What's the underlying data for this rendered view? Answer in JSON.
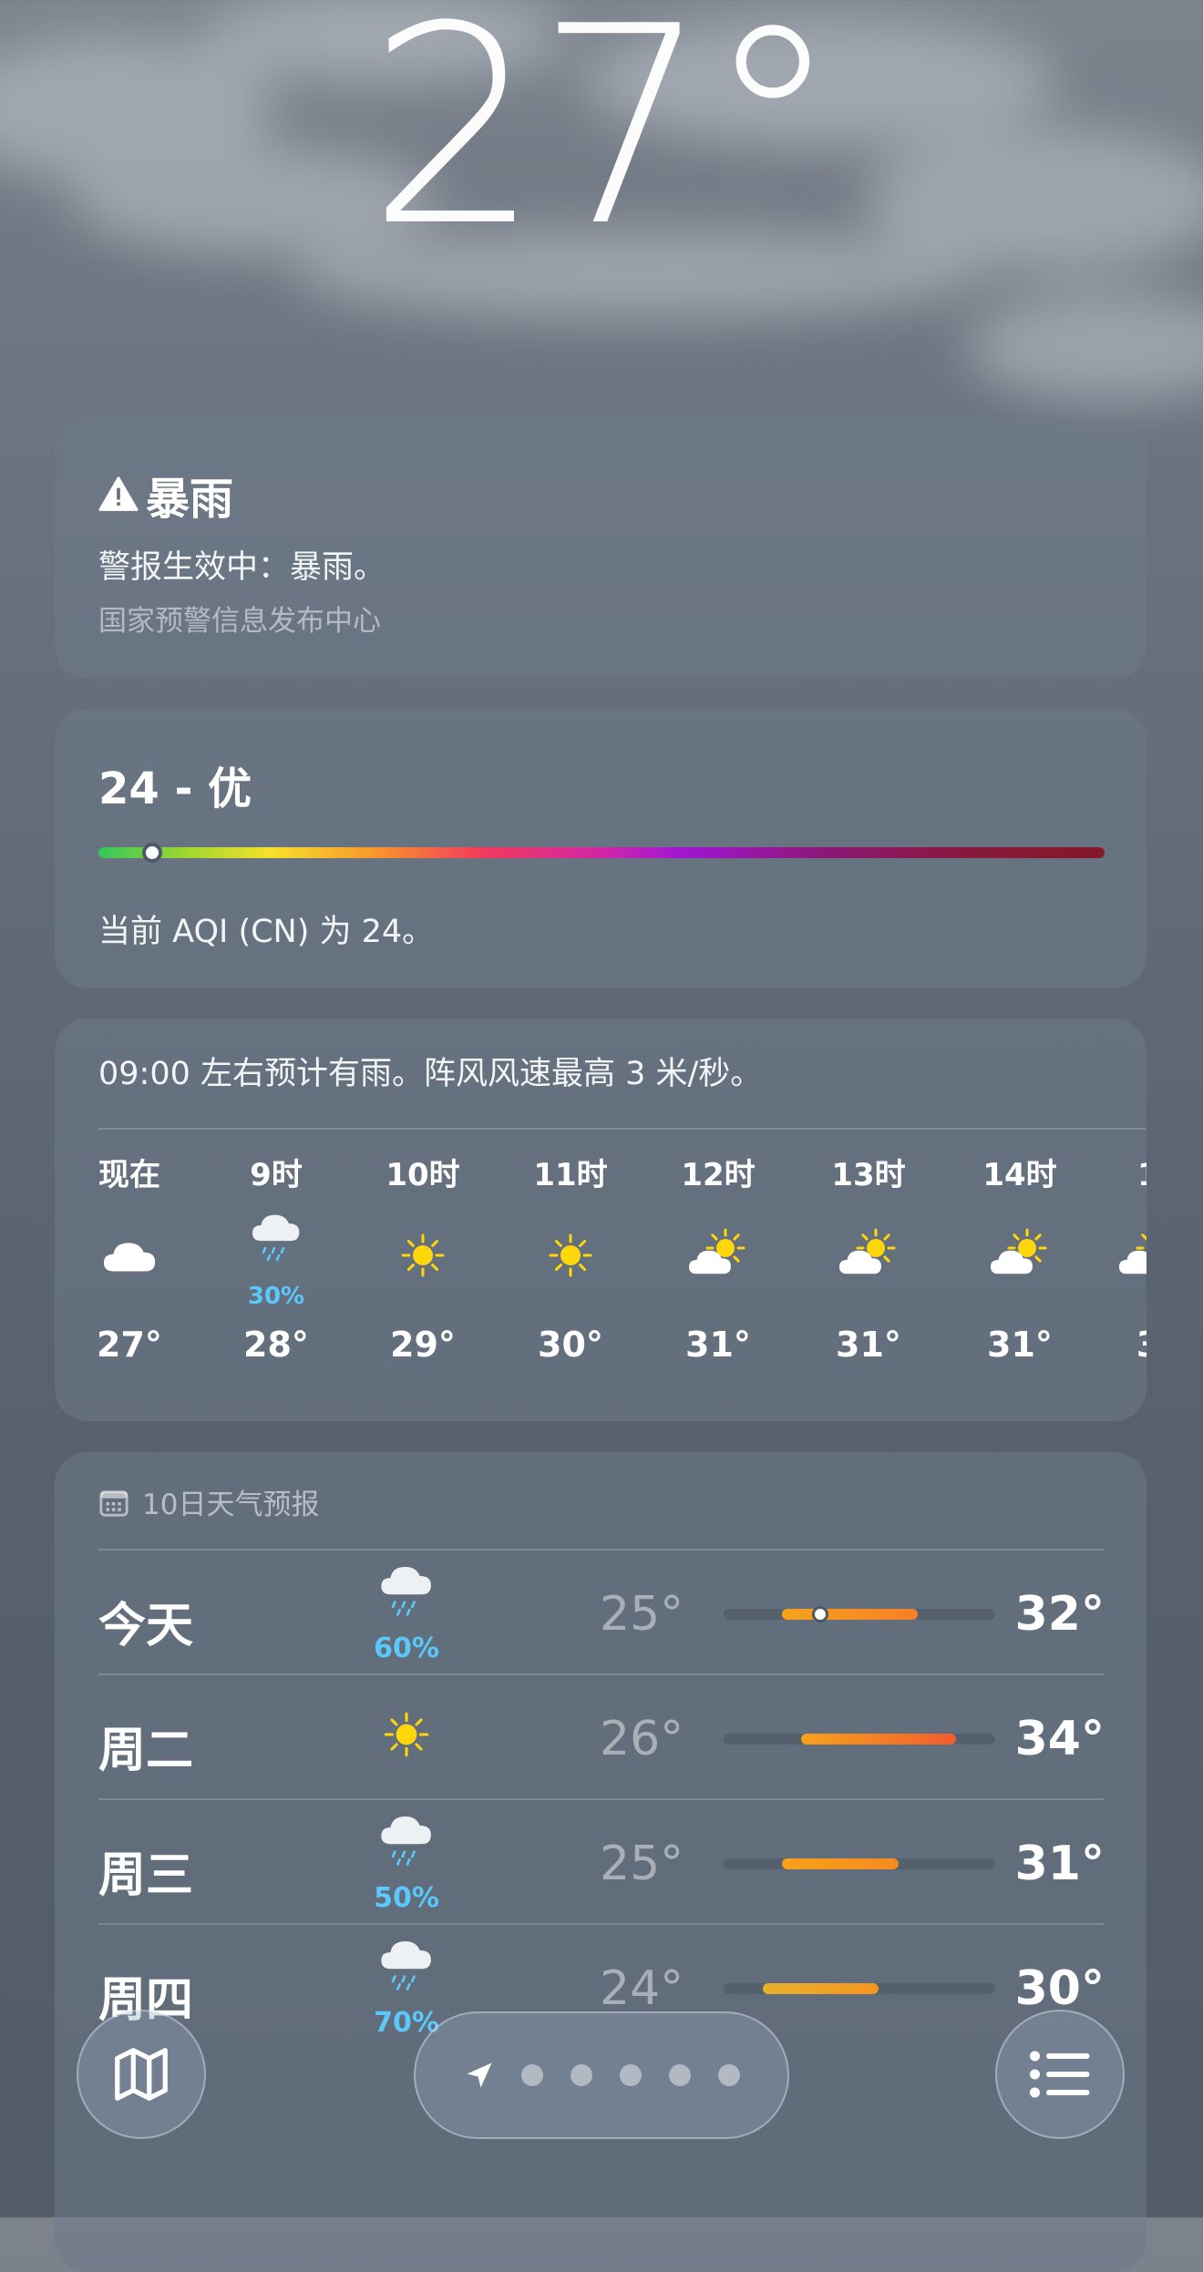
{
  "current": {
    "temperature": "27°"
  },
  "alert": {
    "title": "暴雨",
    "icon": "warning-triangle-icon",
    "message": "警报生效中：暴雨。",
    "source": "国家预警信息发布中心"
  },
  "aqi": {
    "title": "24 - 优",
    "value": 24,
    "position_fraction": 0.053,
    "description": "当前 AQI (CN) 为 24。"
  },
  "hourly": {
    "summary": "09:00 左右预计有雨。阵风风速最高 3 米/秒。",
    "items": [
      {
        "label": "现在",
        "icon": "cloud-icon",
        "temp": "27°"
      },
      {
        "label": "9时",
        "icon": "cloud-rain-icon",
        "pop": "30%",
        "temp": "28°"
      },
      {
        "label": "10时",
        "icon": "sun-icon",
        "temp": "29°"
      },
      {
        "label": "11时",
        "icon": "sun-icon",
        "temp": "30°"
      },
      {
        "label": "12时",
        "icon": "partly-sunny-icon",
        "temp": "31°"
      },
      {
        "label": "13时",
        "icon": "partly-sunny-icon",
        "temp": "31°"
      },
      {
        "label": "14时",
        "icon": "partly-sunny-icon",
        "temp": "31°"
      },
      {
        "label": "1",
        "icon": "partly-sunny-icon",
        "temp": "3"
      }
    ]
  },
  "daily": {
    "header": "10日天气预报",
    "header_icon": "calendar-icon",
    "range": {
      "min": 22,
      "max": 36
    },
    "items": [
      {
        "day": "今天",
        "icon": "cloud-rain-icon",
        "pop": "60%",
        "low": "25°",
        "high": "32°",
        "low_val": 25,
        "high_val": 32,
        "current_val": 27,
        "color_from": "#f7a21b",
        "color_to": "#f57f28"
      },
      {
        "day": "周二",
        "icon": "sun-icon",
        "low": "26°",
        "high": "34°",
        "low_val": 26,
        "high_val": 34,
        "color_from": "#f7a21b",
        "color_to": "#f25c2e"
      },
      {
        "day": "周三",
        "icon": "cloud-rain-icon",
        "pop": "50%",
        "low": "25°",
        "high": "31°",
        "low_val": 25,
        "high_val": 31,
        "color_from": "#f7a21b",
        "color_to": "#f58a22"
      },
      {
        "day": "周四",
        "icon": "cloud-rain-icon",
        "pop": "70%",
        "low": "24°",
        "high": "30°",
        "low_val": 24,
        "high_val": 30,
        "color_from": "#e8b02a",
        "color_to": "#f5951f"
      }
    ]
  },
  "toolbar": {
    "map_icon": "map-icon",
    "location_icon": "location-arrow-icon",
    "page_count": 5,
    "list_icon": "list-icon"
  }
}
